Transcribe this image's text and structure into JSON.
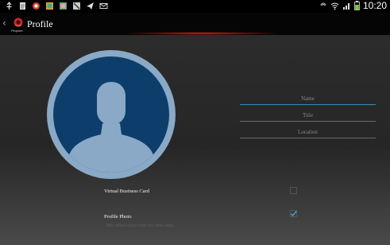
{
  "header": {
    "title": "Profile",
    "logo_text": "Pinpoint",
    "back_glyph": "‹"
  },
  "status_bar": {
    "time": "10:20",
    "icons": [
      "usb-icon",
      "document-icon",
      "app-icon",
      "gallery-icon",
      "gallery-icon",
      "cards-icon",
      "send-icon",
      "email-icon",
      "nfc-icon",
      "wifi-icon",
      "signal-icon",
      "battery-icon"
    ]
  },
  "profile": {
    "avatar_icon": "person-silhouette-icon",
    "fields": {
      "name_placeholder": "Name",
      "title_placeholder": "Title",
      "location_placeholder": "Location"
    },
    "virtual_business_card": {
      "label": "Virtual Business Card",
      "checked": false
    },
    "profile_photo": {
      "label": "Profile Photo",
      "checked": true,
      "hint": "Tells others about more the other other..."
    }
  },
  "colors": {
    "accent": "#2f8fbf",
    "avatar_ring": "#8aa9c6",
    "avatar_fill": "#0d3e6b",
    "header_glow": "#d32020"
  }
}
